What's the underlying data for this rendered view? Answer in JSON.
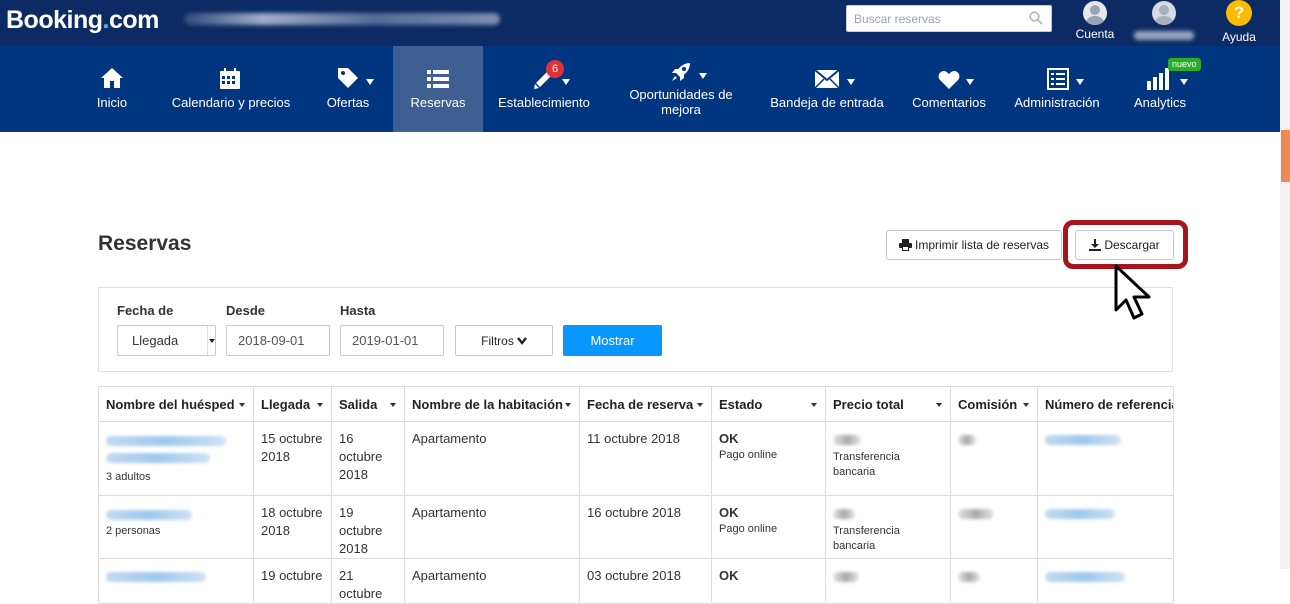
{
  "topbar": {
    "logo_main": "Booking",
    "logo_dot": ".",
    "logo_com": "com",
    "search_placeholder": "Buscar reservas",
    "account_label": "Cuenta",
    "help_label": "Ayuda",
    "help_glyph": "?"
  },
  "nav": {
    "items": [
      {
        "label": "Inicio",
        "icon": "home-icon"
      },
      {
        "label": "Calendario y precios",
        "icon": "calendar-icon"
      },
      {
        "label": "Ofertas",
        "icon": "tag-icon"
      },
      {
        "label": "Reservas",
        "icon": "list-icon",
        "active": true
      },
      {
        "label": "Establecimiento",
        "icon": "pencil-icon",
        "badge": "6"
      },
      {
        "label": "Oportunidades de mejora",
        "icon": "rocket-icon"
      },
      {
        "label": "Bandeja de entrada",
        "icon": "envelope-icon"
      },
      {
        "label": "Comentarios",
        "icon": "heart-icon"
      },
      {
        "label": "Administración",
        "icon": "admin-list-icon"
      },
      {
        "label": "Analytics",
        "icon": "bar-chart-icon",
        "badge": "nuevo"
      }
    ]
  },
  "page": {
    "title": "Reservas",
    "print_label": "Imprimir lista de reservas",
    "download_label": "Descargar"
  },
  "filters": {
    "date_type_label": "Fecha de",
    "date_type_value": "Llegada",
    "from_label": "Desde",
    "from_value": "2018-09-01",
    "to_label": "Hasta",
    "to_value": "2019-01-01",
    "filters_button": "Filtros",
    "show_button": "Mostrar"
  },
  "table": {
    "headers": [
      "Nombre del huésped",
      "Llegada",
      "Salida",
      "Nombre de la habitación",
      "Fecha de reserva",
      "Estado",
      "Precio total",
      "Comisión",
      "Número de referencia"
    ],
    "rows": [
      {
        "guests": "3 adultos",
        "arrival": "15 octubre 2018",
        "departure": "16 octubre 2018",
        "room": "Apartamento",
        "booked": "11 octubre 2018",
        "status": "OK",
        "payment": "Pago online",
        "price_note": "Transferencia bancaria"
      },
      {
        "guests": "2 personas",
        "arrival": "18 octubre 2018",
        "departure": "19 octubre 2018",
        "room": "Apartamento",
        "booked": "16 octubre 2018",
        "status": "OK",
        "payment": "Pago online",
        "price_note": "Transferencia bancaria"
      },
      {
        "guests": "",
        "arrival": "19 octubre",
        "departure": "21 octubre",
        "room": "Apartamento",
        "booked": "03 octubre 2018",
        "status": "OK",
        "payment": "",
        "price_note": ""
      }
    ]
  },
  "colors": {
    "topbar": "#0c2a63",
    "nav": "#003580",
    "nav_active": "#3d5f92",
    "primary_button": "#0896ff",
    "highlight": "#a8141c",
    "badge": "#e0313a",
    "nuevo_badge": "#2bad2a",
    "help": "#febb02"
  }
}
